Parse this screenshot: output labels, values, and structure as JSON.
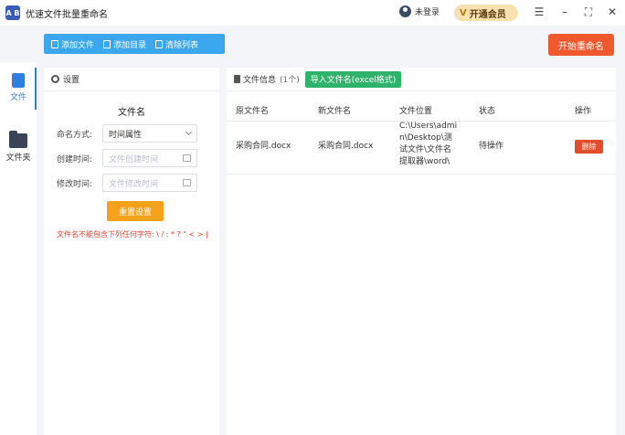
{
  "window": {
    "title": "优速文件批量重命名",
    "login_label": "未登录",
    "vip_label": "开通会员",
    "logo_text": "A B"
  },
  "toolbar": {
    "add_file": "添加文件",
    "add_folder": "添加目录",
    "clear_list": "清除列表",
    "start_rename": "开始重命名"
  },
  "sidenav": {
    "items": [
      {
        "label": "文件",
        "icon": "file-icon",
        "active": true
      },
      {
        "label": "文件夹",
        "icon": "folder-icon",
        "active": false
      }
    ]
  },
  "settings": {
    "header": "设置",
    "section_title": "文件名",
    "naming_mode_label": "命名方式:",
    "naming_mode_value": "时间属性",
    "created_time_label": "创建时间:",
    "created_time_placeholder": "文件创建时间",
    "modified_time_label": "修改时间:",
    "modified_time_placeholder": "文件修改时间",
    "reset_button": "重置设置",
    "warning": "文件名不能包含下列任何字符: \\ / : * ? \" < > |"
  },
  "files": {
    "header": "文件信息",
    "count": "(1个)",
    "import_button": "导入文件名(excel格式)",
    "columns": [
      "原文件名",
      "新文件名",
      "文件位置",
      "状态",
      "操作"
    ],
    "rows": [
      {
        "original": "采购合同.docx",
        "new": "采购合同.docx",
        "location": [
          "C:\\Users\\admi",
          "n\\Desktop\\测",
          "试文件\\文件名",
          "提取器\\word\\"
        ],
        "status": "待操作",
        "action": "删除"
      }
    ]
  }
}
